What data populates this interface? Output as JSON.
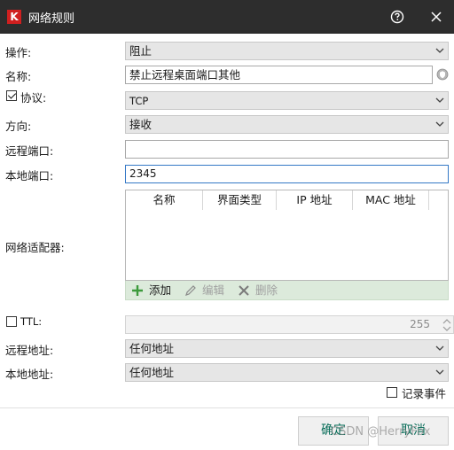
{
  "window": {
    "title": "网络规则",
    "logo_letter": "K"
  },
  "form": {
    "action_label": "操作:",
    "action_value": "阻止",
    "name_label": "名称:",
    "name_value": "禁止远程桌面端口其他",
    "protocol_label": "协议:",
    "protocol_checked": true,
    "protocol_value": "TCP",
    "direction_label": "方向:",
    "direction_value": "接收",
    "remote_port_label": "远程端口:",
    "remote_port_value": "",
    "local_port_label": "本地端口:",
    "local_port_value": "2345",
    "adapters_label": "网络适配器:",
    "adapter_columns": [
      "名称",
      "界面类型",
      "IP 地址",
      "MAC 地址"
    ],
    "adapter_toolbar": {
      "add": "添加",
      "edit": "编辑",
      "delete": "删除"
    },
    "ttl_label": "TTL:",
    "ttl_checked": false,
    "ttl_value": "255",
    "remote_address_label": "远程地址:",
    "remote_address_value": "任何地址",
    "local_address_label": "本地地址:",
    "local_address_value": "任何地址",
    "log_events_label": "记录事件",
    "log_events_checked": false
  },
  "buttons": {
    "ok": "确定",
    "cancel": "取消"
  },
  "watermark": "CSDN @HerryFox",
  "colors": {
    "titlebar": "#2d2d2d",
    "brand_red": "#d01f1f",
    "accent_green": "#0a6e5a",
    "toolbar_bg": "#dceadb"
  }
}
